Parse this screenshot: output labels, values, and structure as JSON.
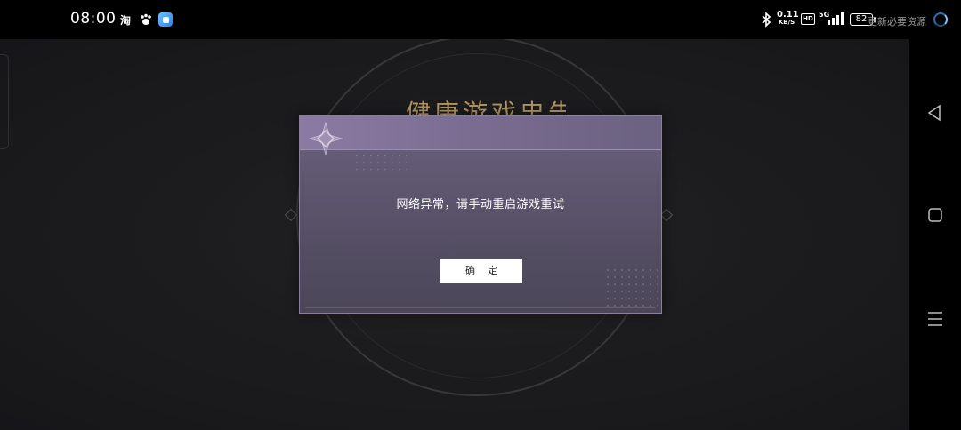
{
  "status_bar": {
    "time": "08:00",
    "app_icons": [
      "taobao-icon",
      "paw-icon",
      "blue-square-app-icon"
    ],
    "taobao_glyph": "淘",
    "net_speed_value": "0.11",
    "net_speed_unit": "KB/S",
    "hd_label": "HD",
    "network_type": "5G",
    "battery_level": "82",
    "notice_text": "更新必要资源"
  },
  "game": {
    "background_title": "健康游戏忠告"
  },
  "dialog": {
    "message": "网络异常，请手动重启游戏重试",
    "confirm_label": "确定"
  },
  "colors": {
    "title_gold": "#d8b679",
    "modal_header": "#8b7ba3",
    "modal_body": "#5c556d",
    "spinner_blue": "#2a6fb0"
  },
  "nav_bar": {
    "icons": [
      "back-triangle-icon",
      "home-square-icon",
      "menu-lines-icon"
    ]
  }
}
